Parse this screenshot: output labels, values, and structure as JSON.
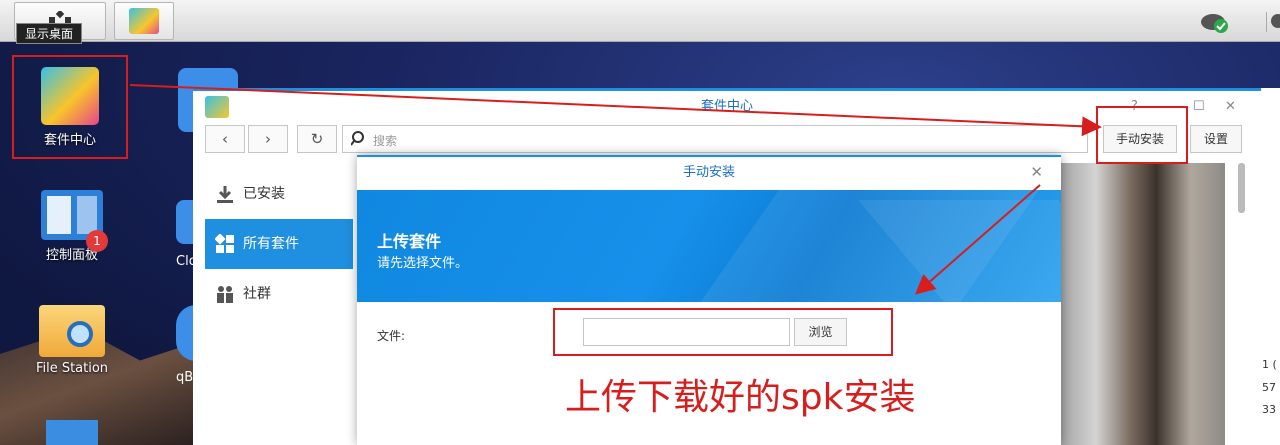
{
  "taskbar": {
    "tooltip": "显示桌面"
  },
  "desktop": {
    "icons": [
      {
        "label": "套件中心"
      },
      {
        "label": "控制面板",
        "badge": "1"
      },
      {
        "label": "File Station"
      },
      {
        "label": "Clo"
      },
      {
        "label": "qB"
      }
    ]
  },
  "window": {
    "title": "套件中心",
    "search_placeholder": "搜索",
    "manual_install": "手动安装",
    "settings": "设置",
    "controls": [
      "?",
      "—",
      "☐",
      "✕"
    ],
    "sidebar": [
      {
        "label": "已安装"
      },
      {
        "label": "所有套件"
      },
      {
        "label": "社群"
      }
    ]
  },
  "dialog": {
    "title": "手动安装",
    "banner_title": "上传套件",
    "banner_sub": "请先选择文件。",
    "file_label": "文件:",
    "browse": "浏览"
  },
  "annotation": "上传下载好的spk安装",
  "right_strip": [
    "1 (",
    "57",
    "33"
  ],
  "colors": {
    "accent": "#1f8fe0",
    "highlight": "#d81d1d"
  }
}
